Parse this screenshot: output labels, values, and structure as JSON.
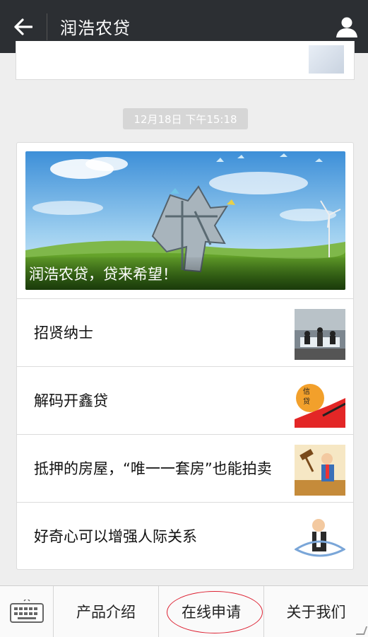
{
  "header": {
    "title": "润浩农贷"
  },
  "timestamp": "12月18日 下午15:18",
  "banner": {
    "caption": "润浩农贷，贷来希望！"
  },
  "articles": [
    {
      "title": "招贤纳士"
    },
    {
      "title": "解码开鑫贷"
    },
    {
      "title": "抵押的房屋，“唯一一套房”也能拍卖"
    },
    {
      "title": "好奇心可以增强人际关系"
    }
  ],
  "bottom_menu": {
    "items": [
      {
        "label": "产品介绍"
      },
      {
        "label": "在线申请"
      },
      {
        "label": "关于我们"
      }
    ]
  },
  "colors": {
    "header_bg": "#2c2f33",
    "page_bg": "#eeeeee",
    "highlight_circle": "#dd2233"
  },
  "icons": {
    "back": "arrow-left-icon",
    "profile": "person-icon",
    "keyboard": "keyboard-icon"
  }
}
